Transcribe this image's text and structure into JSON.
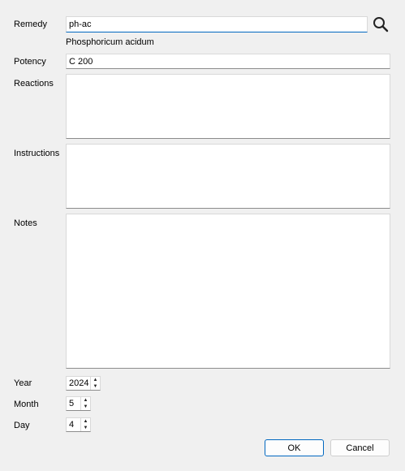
{
  "form": {
    "remedy": {
      "label": "Remedy",
      "value": "ph-ac",
      "resolved_name": "Phosphoricum acidum"
    },
    "potency": {
      "label": "Potency",
      "value": "C 200"
    },
    "reactions": {
      "label": "Reactions",
      "value": ""
    },
    "instructions": {
      "label": "Instructions",
      "value": ""
    },
    "notes": {
      "label": "Notes",
      "value": ""
    },
    "year": {
      "label": "Year",
      "value": "2024"
    },
    "month": {
      "label": "Month",
      "value": "5"
    },
    "day": {
      "label": "Day",
      "value": "4"
    }
  },
  "buttons": {
    "ok": "OK",
    "cancel": "Cancel"
  },
  "icons": {
    "search": "search-icon",
    "spin_up": "up-arrow-icon",
    "spin_down": "down-arrow-icon"
  },
  "colors": {
    "focus_accent": "#0067c0",
    "background": "#f0f0f0"
  }
}
